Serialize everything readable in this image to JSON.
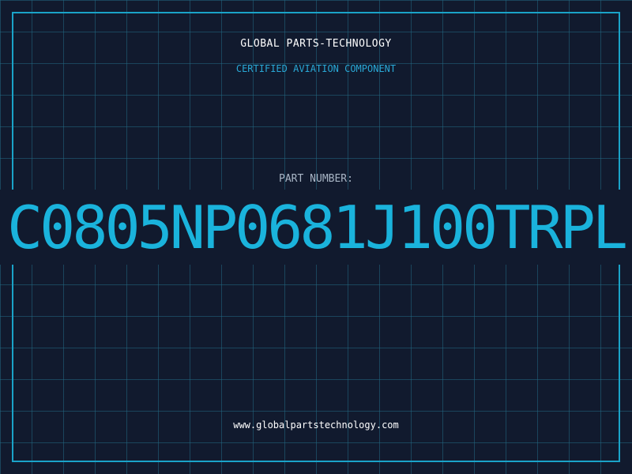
{
  "header": {
    "company": "GLOBAL PARTS-TECHNOLOGY",
    "tagline": "CERTIFIED AVIATION COMPONENT"
  },
  "part": {
    "label": "PART NUMBER:",
    "number": "C0805NP0681J100TRPL"
  },
  "footer": {
    "url": "www.globalpartstechnology.com"
  },
  "colors": {
    "background": "#111a2e",
    "grid": "#226882",
    "frame": "#1aa3c8",
    "accent": "#1ab3dc",
    "muted": "#a9b6c6",
    "text": "#ffffff"
  }
}
